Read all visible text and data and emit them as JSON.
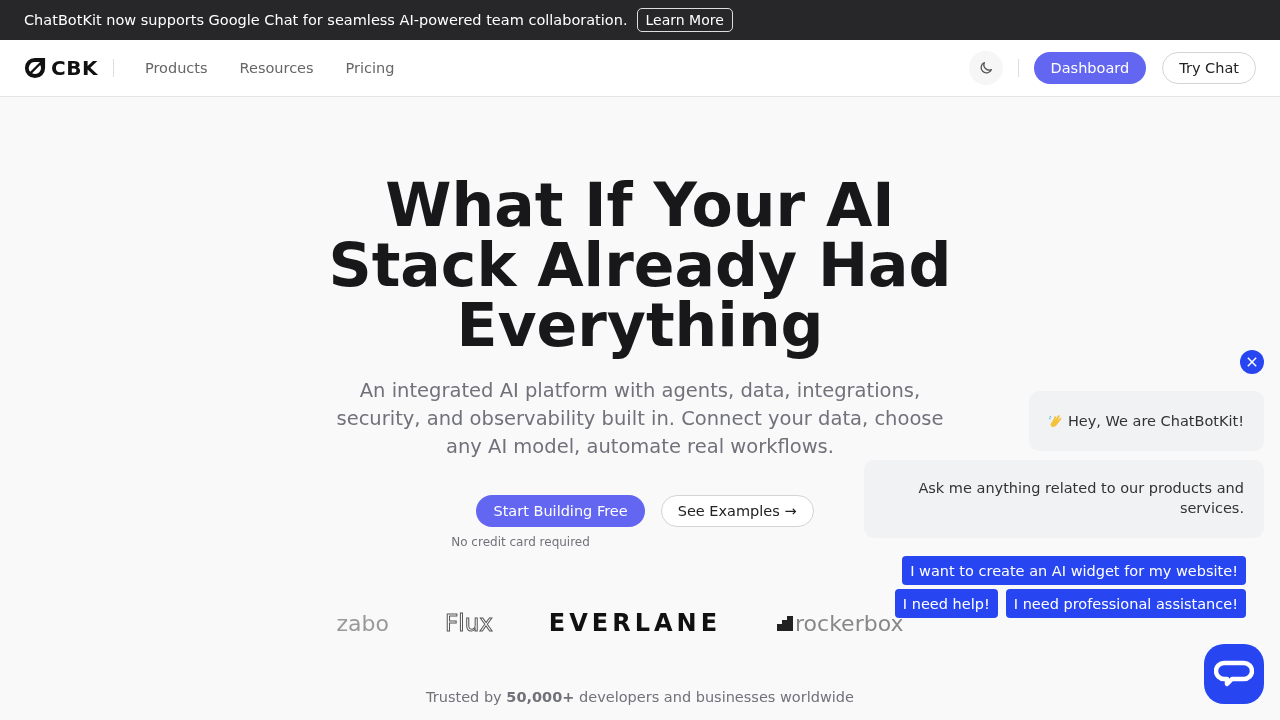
{
  "announcement": {
    "text": "ChatBotKit now supports Google Chat for seamless AI-powered team collaboration.",
    "button": "Learn More"
  },
  "nav": {
    "logo": "CBK",
    "links": [
      "Products",
      "Resources",
      "Pricing"
    ],
    "primary_button": "Dashboard",
    "secondary_button": "Try Chat"
  },
  "hero": {
    "title": "What If Your AI Stack Already Had Everything",
    "subtitle": "An integrated AI platform with agents, data, integrations, security, and observability built in. Connect your data, choose any AI model, automate real workflows.",
    "primary_button": "Start Building Free",
    "secondary_button": "See Examples →",
    "note": "No credit card required"
  },
  "logos": [
    {
      "text": "zabo",
      "kind": "faded"
    },
    {
      "text": "Flux",
      "kind": "outline"
    },
    {
      "text": "EVERLANE",
      "kind": "wide"
    },
    {
      "text": "rockerbox",
      "kind": "steps"
    }
  ],
  "trust": "Trusted by **50,000+** developers and businesses worldwide",
  "chat_widget": {
    "messages": [
      "Hey, We are ChatBotKit!",
      "Ask me anything related to our products and services."
    ],
    "suggestions": [
      "I want to create an AI widget for my website!",
      "I need help!",
      "I need professional assistance!"
    ]
  }
}
